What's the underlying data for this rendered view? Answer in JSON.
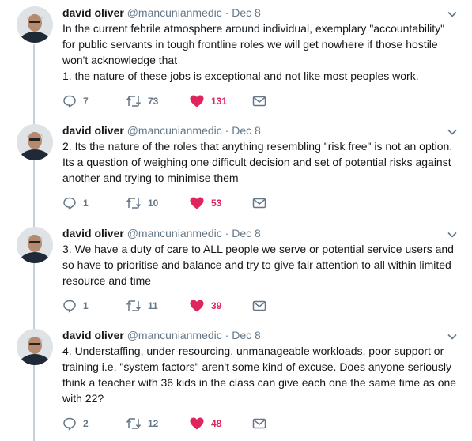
{
  "colors": {
    "accent_like": "#e0245e",
    "muted": "#657786",
    "thread_line": "#c4cfd6"
  },
  "icons": {
    "reply": "reply-icon",
    "retweet": "retweet-icon",
    "like": "heart-icon",
    "dm": "envelope-icon",
    "more": "chevron-down-icon"
  },
  "tweets": [
    {
      "name": "david oliver",
      "handle": "@mancunianmedic",
      "separator": "·",
      "date": "Dec 8",
      "paragraphs": [
        "In the current febrile atmosphere around individual, exemplary \"accountability\" for public servants in tough frontline roles we will get nowhere if those hostile won't acknowledge that",
        "1. the nature of these jobs is exceptional and not like most peoples work."
      ],
      "replies": "7",
      "retweets": "73",
      "likes": "131",
      "liked": true
    },
    {
      "name": "david oliver",
      "handle": "@mancunianmedic",
      "separator": "·",
      "date": "Dec 8",
      "paragraphs": [
        "2. Its the nature of the roles that anything resembling \"risk free\" is not an option. Its a question of weighing one difficult decision and set of potential risks against another and trying to minimise them"
      ],
      "replies": "1",
      "retweets": "10",
      "likes": "53",
      "liked": true
    },
    {
      "name": "david oliver",
      "handle": "@mancunianmedic",
      "separator": "·",
      "date": "Dec 8",
      "paragraphs": [
        "3. We have a duty of care to ALL people we serve or potential service users and so have to prioritise and balance and try to give fair attention to all within limited resource and time"
      ],
      "replies": "1",
      "retweets": "11",
      "likes": "39",
      "liked": true
    },
    {
      "name": "david oliver",
      "handle": "@mancunianmedic",
      "separator": "·",
      "date": "Dec 8",
      "paragraphs": [
        "4. Understaffing, under-resourcing, unmanageable workloads, poor support or training i.e. \"system factors\" aren't some kind of excuse.  Does anyone seriously think a teacher with 36 kids in the class can give each one the same time as one with 22?"
      ],
      "replies": "2",
      "retweets": "12",
      "likes": "48",
      "liked": true
    }
  ]
}
